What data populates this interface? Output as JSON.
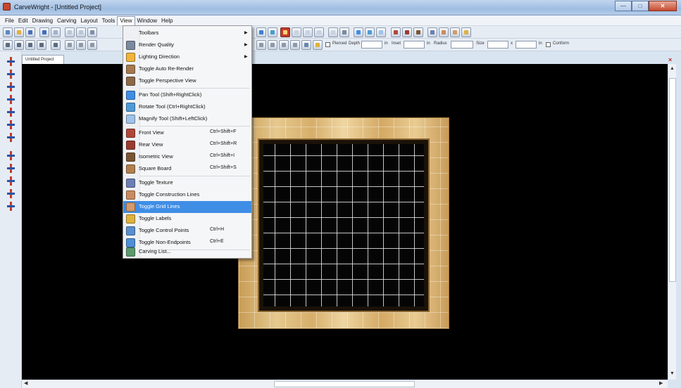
{
  "window": {
    "title": "CarveWright - [Untitled Project]",
    "buttons": {
      "minimize": "—",
      "maximize": "□",
      "close": "✕"
    }
  },
  "menubar": {
    "items": [
      "File",
      "Edit",
      "Drawing",
      "Carving",
      "Layout",
      "Tools",
      "View",
      "Window",
      "Help"
    ],
    "active": "View"
  },
  "toolbar2": {
    "pierced_label": "Pierced",
    "depth_label": "Depth",
    "in1": "in",
    "inset_label": "Inset",
    "in2": "in",
    "radius_label": "Radius",
    "size_label": "Size",
    "x_label": "x",
    "in3": "in",
    "conform_label": "Conform"
  },
  "document": {
    "tab_label": "Untitled Project"
  },
  "view_menu": {
    "items": [
      {
        "label": "Toolbars",
        "shortcut": "",
        "submenu": true,
        "icon": "none",
        "color": "#f5f6f7"
      },
      {
        "label": "Render Quality",
        "shortcut": "",
        "submenu": true,
        "icon": "render-quality-icon",
        "color": "#7b8a9c"
      },
      {
        "label": "Lighting Direction",
        "shortcut": "",
        "submenu": true,
        "icon": "lighting-icon",
        "color": "#f0b43a"
      },
      {
        "label": "Toggle Auto Re-Render",
        "shortcut": "",
        "submenu": false,
        "icon": "auto-render-icon",
        "color": "#a57a4c"
      },
      {
        "label": "Toggle Perspective View",
        "shortcut": "",
        "submenu": false,
        "icon": "perspective-icon",
        "color": "#8c6a45"
      },
      {
        "label": "Pan Tool (Shift+RightClick)",
        "shortcut": "",
        "submenu": false,
        "icon": "pan-tool-icon",
        "color": "#3f8ee6"
      },
      {
        "label": "Rotate Tool (Ctrl+RightClick)",
        "shortcut": "",
        "submenu": false,
        "icon": "rotate-tool-icon",
        "color": "#4d9ad8"
      },
      {
        "label": "Magnify Tool (Shift+LeftClick)",
        "shortcut": "",
        "submenu": false,
        "icon": "magnify-tool-icon",
        "color": "#9fc3ea"
      },
      {
        "label": "Front View",
        "shortcut": "Ctrl+Shift+F",
        "submenu": false,
        "icon": "front-view-icon",
        "color": "#b0483a"
      },
      {
        "label": "Rear View",
        "shortcut": "Ctrl+Shift+R",
        "submenu": false,
        "icon": "rear-view-icon",
        "color": "#9b3b2f"
      },
      {
        "label": "Isometric View",
        "shortcut": "Ctrl+Shift+I",
        "submenu": false,
        "icon": "isometric-view-icon",
        "color": "#7a5533"
      },
      {
        "label": "Square Board",
        "shortcut": "Ctrl+Shift+S",
        "submenu": false,
        "icon": "square-board-icon",
        "color": "#b37f4f"
      },
      {
        "label": "Toggle Texture",
        "shortcut": "",
        "submenu": false,
        "icon": "texture-icon",
        "color": "#6b7fb6"
      },
      {
        "label": "Toggle Construction Lines",
        "shortcut": "",
        "submenu": false,
        "icon": "construction-lines-icon",
        "color": "#c98a5e"
      },
      {
        "label": "Toggle Grid Lines",
        "shortcut": "",
        "submenu": false,
        "icon": "grid-lines-icon",
        "color": "#d49a6a"
      },
      {
        "label": "Toggle Labels",
        "shortcut": "",
        "submenu": false,
        "icon": "labels-icon",
        "color": "#e0b23c"
      },
      {
        "label": "Toggle Control Points",
        "shortcut": "Ctrl+H",
        "submenu": false,
        "icon": "control-points-icon",
        "color": "#5a8fd0"
      },
      {
        "label": "Toggle Non-Endpoints",
        "shortcut": "Ctrl+E",
        "submenu": false,
        "icon": "non-endpoints-icon",
        "color": "#4f8fd8"
      },
      {
        "label": "Carving List...",
        "shortcut": "",
        "submenu": false,
        "icon": "carving-list-icon",
        "color": "#5b9a6c"
      }
    ],
    "highlighted": "Toggle Grid Lines"
  }
}
